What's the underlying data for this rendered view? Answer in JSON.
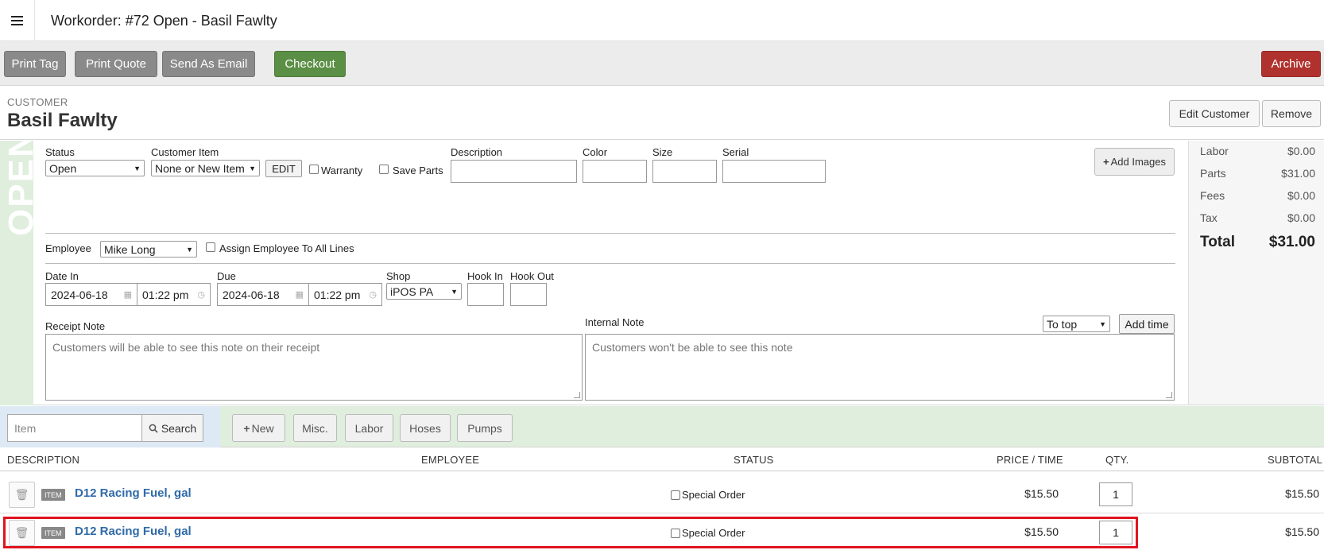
{
  "header": {
    "title": "Workorder:  #72 Open - Basil Fawlty"
  },
  "toolbar": {
    "print_tag": "Print Tag",
    "print_quote": "Print Quote",
    "send_email": "Send As Email",
    "checkout": "Checkout",
    "archive": "Archive"
  },
  "customer": {
    "label": "CUSTOMER",
    "name": "Basil Fawlty",
    "edit_button": "Edit Customer",
    "remove_button": "Remove"
  },
  "workorder": {
    "status_strip": "OPEN",
    "status_label": "Status",
    "status_value": "Open",
    "customer_item_label": "Customer Item",
    "customer_item_value": "None or New Item",
    "edit_button": "EDIT",
    "warranty_label": "Warranty",
    "save_parts_label": "Save Parts",
    "description_label": "Description",
    "color_label": "Color",
    "size_label": "Size",
    "serial_label": "Serial",
    "add_images": "Add Images",
    "employee_label": "Employee",
    "employee_value": "Mike Long",
    "assign_all_label": "Assign Employee To All Lines",
    "date_in_label": "Date In",
    "date_in": "2024-06-18",
    "time_in": "01:22 pm",
    "due_label": "Due",
    "due_date": "2024-06-18",
    "due_time": "01:22 pm",
    "shop_label": "Shop",
    "shop_value": "iPOS PA",
    "hook_in_label": "Hook In",
    "hook_out_label": "Hook Out",
    "receipt_note_label": "Receipt Note",
    "receipt_note_placeholder": "Customers will be able to see this note on their receipt",
    "internal_note_label": "Internal Note",
    "internal_note_placeholder": "Customers won't be able to see this note",
    "note_position": "To top",
    "add_time": "Add time"
  },
  "totals": {
    "labor_label": "Labor",
    "labor": "$0.00",
    "parts_label": "Parts",
    "parts": "$31.00",
    "fees_label": "Fees",
    "fees": "$0.00",
    "tax_label": "Tax",
    "tax": "$0.00",
    "total_label": "Total",
    "total": "$31.00"
  },
  "itembar": {
    "search_placeholder": "Item",
    "search_button": "Search",
    "new_button": "New",
    "misc_button": "Misc.",
    "labor_button": "Labor",
    "hoses_button": "Hoses",
    "pumps_button": "Pumps"
  },
  "table": {
    "headers": {
      "description": "DESCRIPTION",
      "employee": "EMPLOYEE",
      "status": "STATUS",
      "price": "PRICE / TIME",
      "qty": "QTY.",
      "subtotal": "SUBTOTAL"
    },
    "rows": [
      {
        "tag": "ITEM",
        "description": "D12 Racing Fuel, gal",
        "status": "Special Order",
        "price": "$15.50",
        "qty": "1",
        "subtotal": "$15.50"
      },
      {
        "tag": "ITEM",
        "description": "D12 Racing Fuel, gal",
        "status": "Special Order",
        "price": "$15.50",
        "qty": "1",
        "subtotal": "$15.50"
      }
    ]
  },
  "colors": {
    "accent_green": "#5b8f45",
    "archive_red": "#b0322e",
    "link_blue": "#2f6aa8",
    "highlight_red": "#e0141e"
  }
}
